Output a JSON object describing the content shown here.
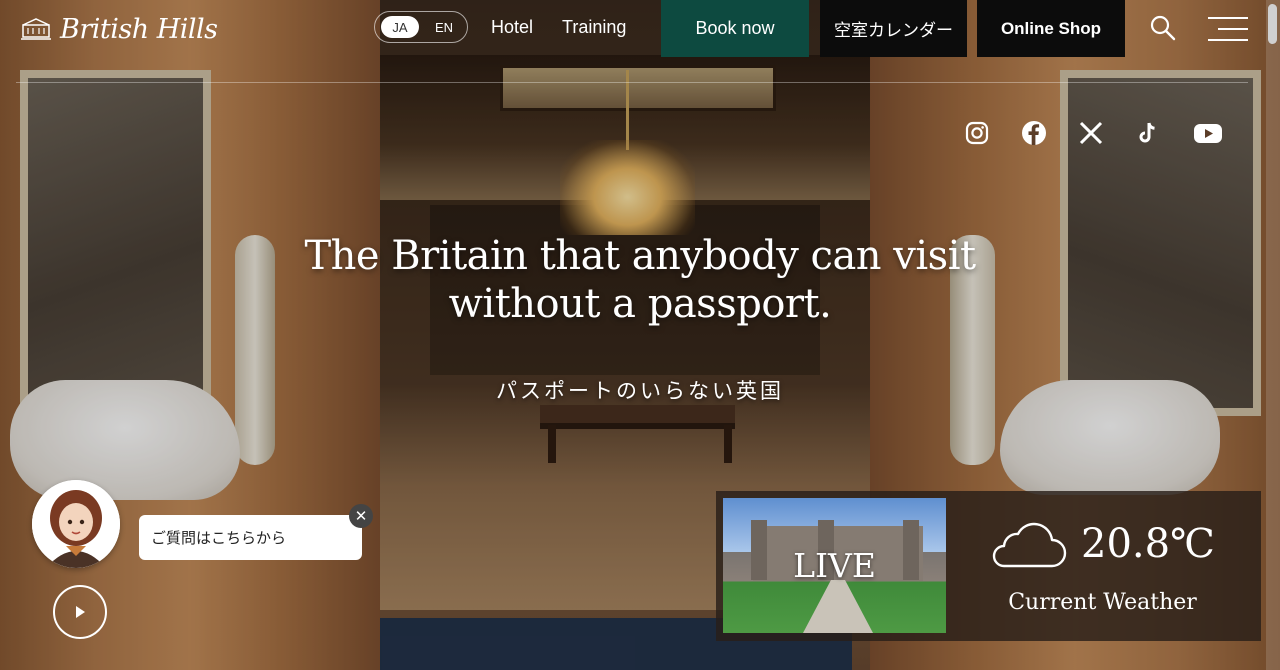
{
  "header": {
    "logo_text": "British Hills",
    "lang_ja": "JA",
    "lang_en": "EN",
    "nav_hotel": "Hotel",
    "nav_training": "Training",
    "book_now": "Book now",
    "calendar": "空室カレンダー",
    "online_shop": "Online Shop"
  },
  "socials": [
    "instagram-icon",
    "facebook-icon",
    "x-icon",
    "tiktok-icon",
    "youtube-icon"
  ],
  "hero": {
    "title_line1": "The Britain that anybody can visit",
    "title_line2": "without a passport.",
    "subtitle": "パスポートのいらない英国"
  },
  "chat": {
    "message": "ご質問はこちらから",
    "close": "✕"
  },
  "live": {
    "label": "LIVE"
  },
  "weather": {
    "temperature": "20.8℃",
    "label": "Current Weather",
    "icon": "cloud-icon"
  },
  "colors": {
    "book_now_bg": "#0d4a40",
    "dark_button_bg": "#0c0c0c"
  }
}
